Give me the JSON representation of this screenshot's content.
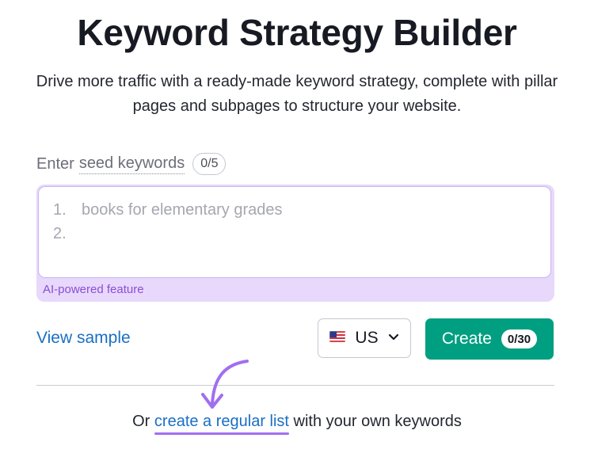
{
  "header": {
    "title": "Keyword Strategy Builder",
    "subtitle": "Drive more traffic with a ready-made keyword strategy, complete with pillar pages and subpages to structure your website."
  },
  "seed": {
    "label_prefix": "Enter",
    "label_link": "seed keywords",
    "counter": "0/5",
    "lines": [
      {
        "number": "1.",
        "placeholder": "books for elementary grades"
      },
      {
        "number": "2.",
        "placeholder": ""
      }
    ],
    "ai_label": "AI-powered feature"
  },
  "actions": {
    "view_sample": "View sample",
    "country_code": "US",
    "country_flag_icon": "us-flag-icon",
    "create_label": "Create",
    "create_limit": "0/30"
  },
  "footer": {
    "prefix": "Or",
    "link": "create a regular list",
    "suffix": "with your own keywords"
  },
  "colors": {
    "accent_green": "#009f81",
    "link_blue": "#1a6fc4",
    "ai_purple": "#8a4ed6",
    "annotation_purple": "#a06ff0"
  }
}
